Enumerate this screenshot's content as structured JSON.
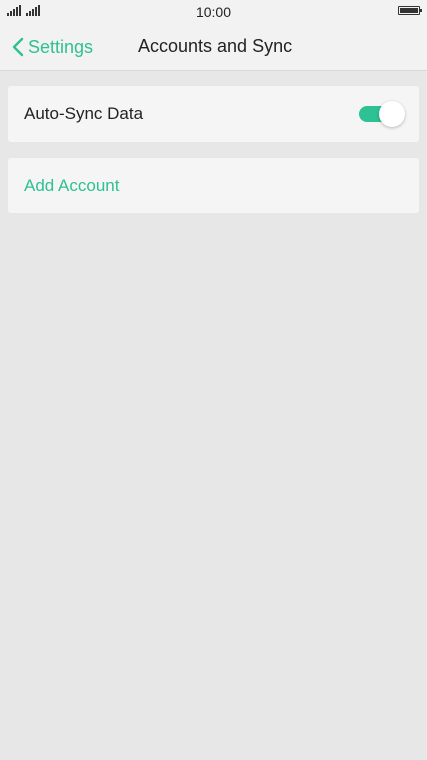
{
  "status_bar": {
    "time": "10:00"
  },
  "header": {
    "back_label": "Settings",
    "title": "Accounts and Sync"
  },
  "settings": {
    "auto_sync_label": "Auto-Sync Data",
    "auto_sync_enabled": true,
    "add_account_label": "Add Account"
  },
  "icons": {
    "back": "chevron-left-icon",
    "signal": "signal-icon",
    "battery": "battery-icon"
  },
  "colors": {
    "accent": "#2ec193",
    "background": "#e7e7e7",
    "card": "#f5f5f5"
  }
}
